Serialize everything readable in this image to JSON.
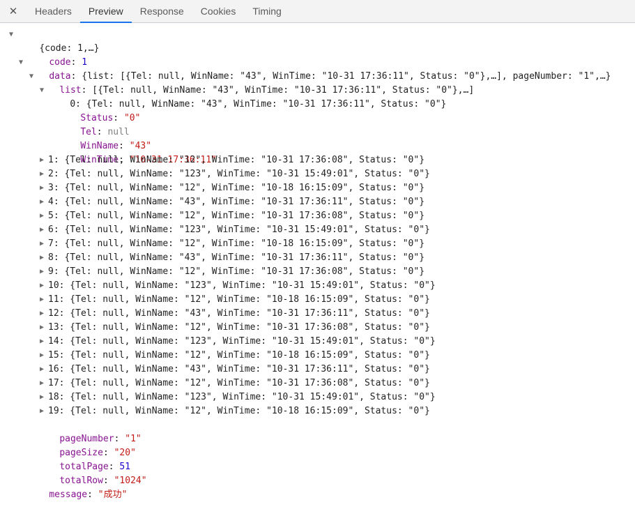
{
  "tabs": {
    "close": "✕",
    "items": [
      "Headers",
      "Preview",
      "Response",
      "Cookies",
      "Timing"
    ],
    "active": "Preview"
  },
  "root": {
    "summary": "{code: 1,…}",
    "code": {
      "key": "code",
      "value": "1"
    },
    "data": {
      "key": "data",
      "summary": "{list: [{Tel: null, WinName: \"43\", WinTime: \"10-31 17:36:11\", Status: \"0\"},…], pageNumber: \"1\",…}",
      "list": {
        "key": "list",
        "summary": "[{Tel: null, WinName: \"43\", WinTime: \"10-31 17:36:11\", Status: \"0\"},…]",
        "expanded_item": {
          "summary": "0: {Tel: null, WinName: \"43\", WinTime: \"10-31 17:36:11\", Status: \"0\"}",
          "fields": [
            {
              "key": "Status",
              "value": "\"0\"",
              "kind": "str"
            },
            {
              "key": "Tel",
              "value": "null",
              "kind": "null"
            },
            {
              "key": "WinName",
              "value": "\"43\"",
              "kind": "str"
            },
            {
              "key": "WinTime",
              "value": "\"10-31 17:36:11\"",
              "kind": "str"
            }
          ]
        },
        "collapsed_items": [
          "1: {Tel: null, WinName: \"12\", WinTime: \"10-31 17:36:08\", Status: \"0\"}",
          "2: {Tel: null, WinName: \"123\", WinTime: \"10-31 15:49:01\", Status: \"0\"}",
          "3: {Tel: null, WinName: \"12\", WinTime: \"10-18 16:15:09\", Status: \"0\"}",
          "4: {Tel: null, WinName: \"43\", WinTime: \"10-31 17:36:11\", Status: \"0\"}",
          "5: {Tel: null, WinName: \"12\", WinTime: \"10-31 17:36:08\", Status: \"0\"}",
          "6: {Tel: null, WinName: \"123\", WinTime: \"10-31 15:49:01\", Status: \"0\"}",
          "7: {Tel: null, WinName: \"12\", WinTime: \"10-18 16:15:09\", Status: \"0\"}",
          "8: {Tel: null, WinName: \"43\", WinTime: \"10-31 17:36:11\", Status: \"0\"}",
          "9: {Tel: null, WinName: \"12\", WinTime: \"10-31 17:36:08\", Status: \"0\"}",
          "10: {Tel: null, WinName: \"123\", WinTime: \"10-31 15:49:01\", Status: \"0\"}",
          "11: {Tel: null, WinName: \"12\", WinTime: \"10-18 16:15:09\", Status: \"0\"}",
          "12: {Tel: null, WinName: \"43\", WinTime: \"10-31 17:36:11\", Status: \"0\"}",
          "13: {Tel: null, WinName: \"12\", WinTime: \"10-31 17:36:08\", Status: \"0\"}",
          "14: {Tel: null, WinName: \"123\", WinTime: \"10-31 15:49:01\", Status: \"0\"}",
          "15: {Tel: null, WinName: \"12\", WinTime: \"10-18 16:15:09\", Status: \"0\"}",
          "16: {Tel: null, WinName: \"43\", WinTime: \"10-31 17:36:11\", Status: \"0\"}",
          "17: {Tel: null, WinName: \"12\", WinTime: \"10-31 17:36:08\", Status: \"0\"}",
          "18: {Tel: null, WinName: \"123\", WinTime: \"10-31 15:49:01\", Status: \"0\"}",
          "19: {Tel: null, WinName: \"12\", WinTime: \"10-18 16:15:09\", Status: \"0\"}"
        ]
      },
      "pageNumber": {
        "key": "pageNumber",
        "value": "\"1\""
      },
      "pageSize": {
        "key": "pageSize",
        "value": "\"20\""
      },
      "totalPage": {
        "key": "totalPage",
        "value": "51"
      },
      "totalRow": {
        "key": "totalRow",
        "value": "\"1024\""
      }
    },
    "message": {
      "key": "message",
      "value": "\"成功\""
    }
  },
  "colors": {
    "key": "#881391",
    "string": "#c41a16",
    "number": "#1c00cf",
    "null": "#808080",
    "active_tab_underline": "#1a73e8"
  }
}
